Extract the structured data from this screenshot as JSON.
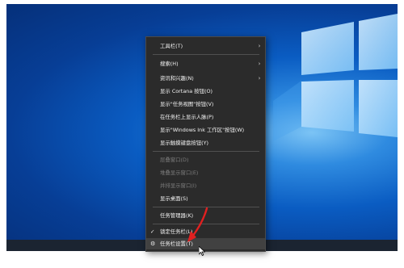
{
  "colors": {
    "menu_bg": "#2b2b2b",
    "menu_text": "#f2f2f2",
    "menu_disabled_text": "#7c7c7c",
    "desktop_blue": "#0a5cc2",
    "annotation_red": "#e02020"
  },
  "context_menu": {
    "items": [
      {
        "label": "工具栏(T)",
        "has_submenu": true
      },
      {
        "label": "搜索(H)",
        "has_submenu": true
      },
      {
        "label": "资讯和兴趣(N)",
        "has_submenu": true
      },
      {
        "label": "显示 Cortana 按钮(O)"
      },
      {
        "label": "显示\"任务视图\"按钮(V)"
      },
      {
        "label": "在任务栏上显示人脉(P)"
      },
      {
        "label": "显示\"Windows Ink 工作区\"按钮(W)"
      },
      {
        "label": "显示触摸键盘按钮(Y)"
      },
      {
        "label": "层叠窗口(D)",
        "disabled": true
      },
      {
        "label": "堆叠显示窗口(E)",
        "disabled": true
      },
      {
        "label": "并排显示窗口(I)",
        "disabled": true
      },
      {
        "label": "显示桌面(S)"
      },
      {
        "label": "任务管理器(K)"
      },
      {
        "label": "锁定任务栏(L)",
        "checked": true
      },
      {
        "label": "任务栏设置(T)",
        "icon": "gear-icon"
      }
    ],
    "check_glyph": "✓",
    "gear_glyph": "⚙",
    "submenu_glyph": "›"
  },
  "annotation": {
    "icon": "red-arrow-icon"
  },
  "pointer": {
    "icon": "mouse-cursor-icon"
  }
}
